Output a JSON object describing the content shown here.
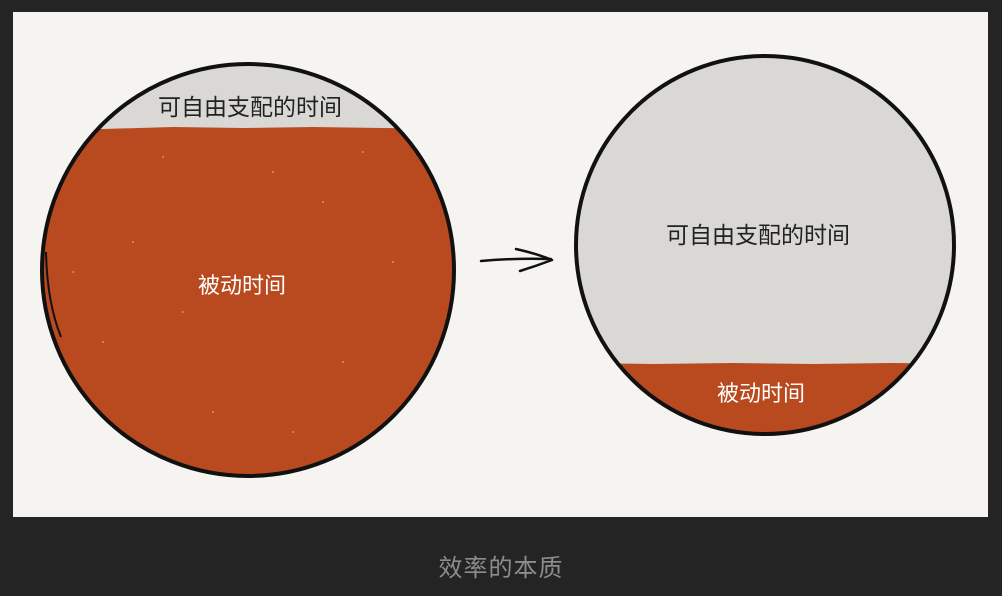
{
  "diagram": {
    "left_circle": {
      "free_time_label": "可自由支配的时间",
      "passive_time_label": "被动时间"
    },
    "right_circle": {
      "free_time_label": "可自由支配的时间",
      "passive_time_label": "被动时间"
    },
    "caption": "效率的本质",
    "colors": {
      "passive": "#b94a20",
      "free": "#d9d8d4",
      "background": "#f5f4f0",
      "outline": "#111111"
    }
  }
}
